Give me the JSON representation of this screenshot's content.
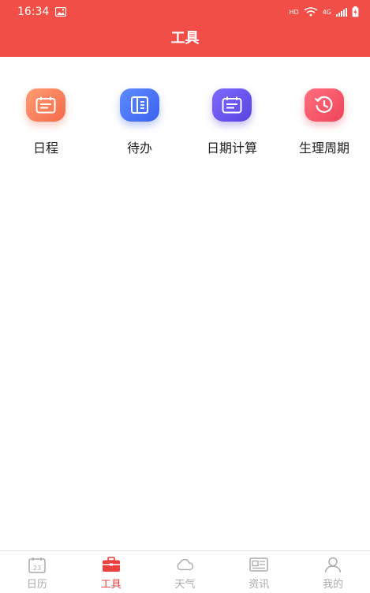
{
  "status": {
    "time": "16:34",
    "network": "HD",
    "cellular": "4G"
  },
  "header": {
    "title": "工具"
  },
  "tools": [
    {
      "label": "日程",
      "icon": "calendar-icon",
      "color": "#f46a4a"
    },
    {
      "label": "待办",
      "icon": "notebook-icon",
      "color": "#3c63ee"
    },
    {
      "label": "日期计算",
      "icon": "calendar-icon",
      "color": "#5a44e0"
    },
    {
      "label": "生理周期",
      "icon": "clock-icon",
      "color": "#ee4459"
    }
  ],
  "tabbar": {
    "calendar_badge": "23",
    "items": [
      {
        "label": "日历",
        "icon": "calendar-icon",
        "active": false
      },
      {
        "label": "工具",
        "icon": "toolbox-icon",
        "active": true
      },
      {
        "label": "天气",
        "icon": "cloud-icon",
        "active": false
      },
      {
        "label": "资讯",
        "icon": "news-icon",
        "active": false
      },
      {
        "label": "我的",
        "icon": "user-icon",
        "active": false
      }
    ]
  },
  "colors": {
    "accent": "#f04e47",
    "tab_active": "#e8403c",
    "tab_inactive": "#aaaaaa"
  }
}
